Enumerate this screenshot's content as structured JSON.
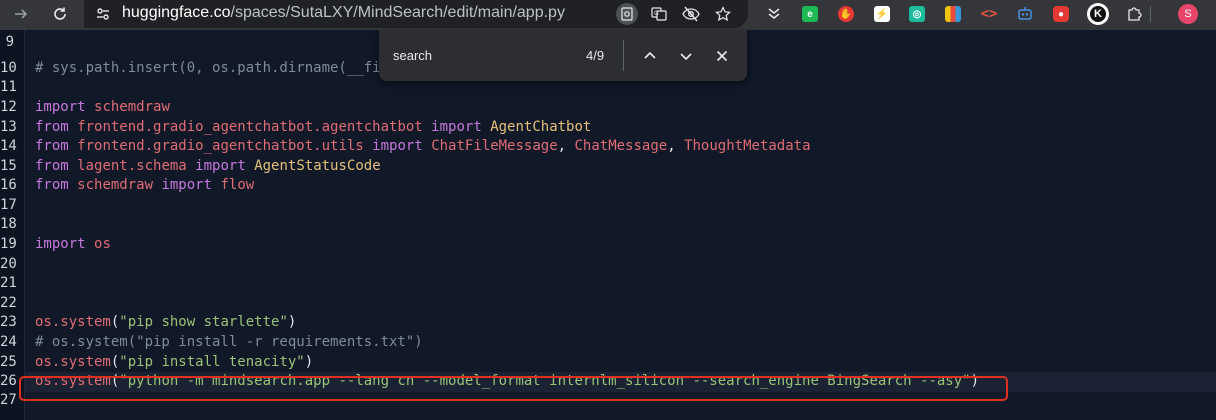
{
  "browser": {
    "url_host": "huggingface.co",
    "url_path": "/spaces/SutaLXY/MindSearch/edit/main/app.py",
    "profile_initial": "S",
    "extensions": [
      {
        "icon": "evernote-icon",
        "color": "#1db954"
      },
      {
        "icon": "red-hand-icon",
        "color": "#e53935"
      },
      {
        "icon": "lightning-icon",
        "color": "#ffffff"
      },
      {
        "icon": "green-swirl-icon",
        "color": "#1abc9c"
      },
      {
        "icon": "colorful-grid-icon",
        "color": "#333333"
      },
      {
        "icon": "code-brackets-icon",
        "color": "#e8563f"
      },
      {
        "icon": "bot-icon",
        "color": "#4a90e2"
      },
      {
        "icon": "red-app-icon",
        "color": "#e53935"
      },
      {
        "icon": "k-icon",
        "color": "#ffffff"
      }
    ]
  },
  "find_bar": {
    "query": "search",
    "count": "4/9"
  },
  "editor": {
    "line_numbers": [
      "9",
      "10",
      "11",
      "12",
      "13",
      "14",
      "15",
      "16",
      "17",
      "18",
      "19",
      "20",
      "21",
      "22",
      "23",
      "24",
      "25",
      "26",
      "27"
    ],
    "lines": [
      "",
      "# sys.path.insert(0, os.path.dirname(__fi",
      "",
      "import schemdraw",
      "from frontend.gradio_agentchatbot.agentchatbot import AgentChatbot",
      "from frontend.gradio_agentchatbot.utils import ChatFileMessage, ChatMessage, ThoughtMetadata",
      "from lagent.schema import AgentStatusCode",
      "from schemdraw import flow",
      "",
      "",
      "import os",
      "",
      "",
      "",
      "os.system(\"pip show starlette\")",
      "# os.system(\"pip install -r requirements.txt\")",
      "os.system(\"pip install tenacity\")",
      "os.system(\"python -m mindsearch.app --lang cn --model_format internlm_silicon --search_engine BingSearch --asy\")",
      ""
    ],
    "tokens": {
      "cmt_10": "# sys.path.insert(0, os.path.dirname(__fi",
      "kw_import": "import",
      "kw_from": "from",
      "schemdraw": "schemdraw",
      "frontend_agentchatbot": "frontend.gradio_agentchatbot.agentchatbot",
      "AgentChatbot": "AgentChatbot",
      "frontend_utils": "frontend.gradio_agentchatbot.utils",
      "ChatFileMessage": "ChatFileMessage",
      "ChatMessage": "ChatMessage",
      "ThoughtMetadata": "ThoughtMetadata",
      "lagent_schema": "lagent.schema",
      "AgentStatusCode": "AgentStatusCode",
      "flow": "flow",
      "os": "os",
      "os_system": "os.system",
      "paren_open": "(",
      "paren_close": ")",
      "comma": ", ",
      "str_23": "\"pip show starlette\"",
      "cmt_24": "# os.system(\"pip install -r requirements.txt\")",
      "str_25": "\"pip install tenacity\"",
      "str_26": "\"python -m mindsearch.app --lang cn --model_format internlm_silicon --search_engine BingSearch --asy\""
    }
  },
  "colors": {
    "editor_bg": "#111827",
    "keyword": "#c678dd",
    "module": "#e06c75",
    "string": "#98c379",
    "comment": "#7f8a9a",
    "class_name": "#e5c07b",
    "highlight_box": "#e0301e"
  }
}
